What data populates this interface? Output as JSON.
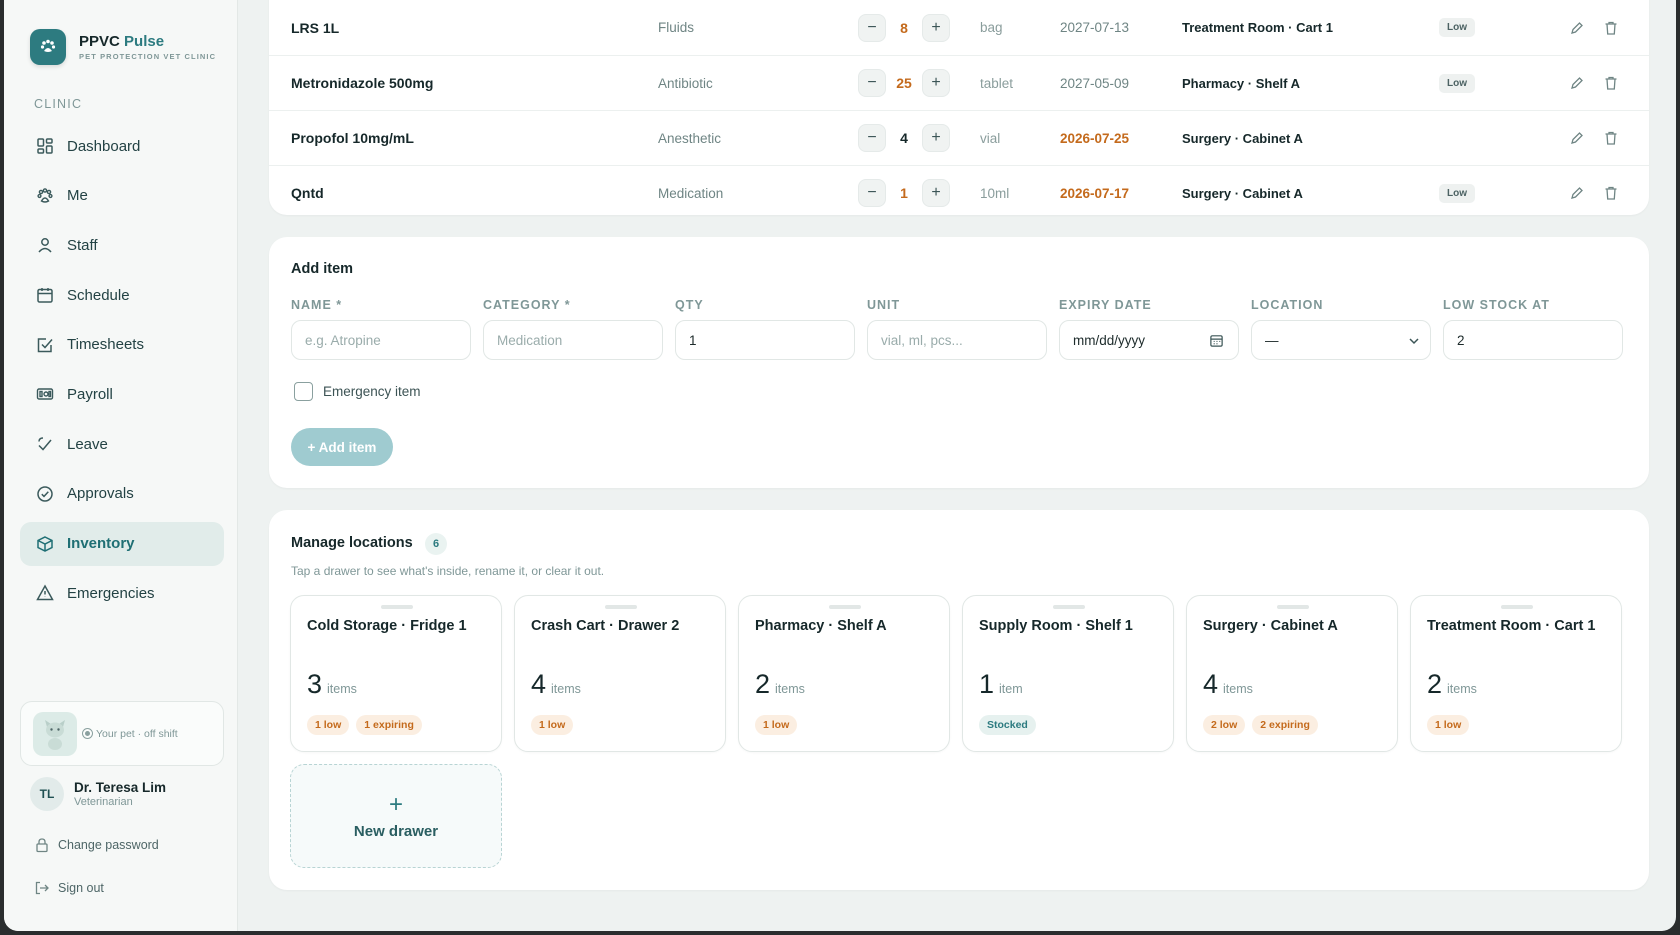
{
  "brand": {
    "name": "PPVC",
    "name_accent": "Pulse",
    "subtitle": "PET PROTECTION VET CLINIC"
  },
  "sidebar": {
    "section": "CLINIC",
    "items": [
      {
        "label": "Dashboard",
        "icon": "grid-icon"
      },
      {
        "label": "Me",
        "icon": "paw-icon"
      },
      {
        "label": "Staff",
        "icon": "user-icon"
      },
      {
        "label": "Schedule",
        "icon": "calendar-icon"
      },
      {
        "label": "Timesheets",
        "icon": "checkbox-icon"
      },
      {
        "label": "Payroll",
        "icon": "money-icon"
      },
      {
        "label": "Leave",
        "icon": "leave-icon"
      },
      {
        "label": "Approvals",
        "icon": "check-circle-icon"
      },
      {
        "label": "Inventory",
        "icon": "box-icon",
        "active": true
      },
      {
        "label": "Emergencies",
        "icon": "warning-icon"
      }
    ],
    "pet_status": "Your pet · off shift",
    "user": {
      "initials": "TL",
      "name": "Dr. Teresa Lim",
      "role": "Veterinarian"
    },
    "change_password": "Change password",
    "sign_out": "Sign out"
  },
  "inventory_rows": [
    {
      "name": "LRS 1L",
      "category": "Fluids",
      "qty": "8",
      "unit": "bag",
      "expiry": "2027-07-13",
      "location": "Treatment Room · Cart 1",
      "badge": "Low"
    },
    {
      "name": "Metronidazole 500mg",
      "category": "Antibiotic",
      "qty": "25",
      "unit": "tablet",
      "expiry": "2027-05-09",
      "location": "Pharmacy · Shelf A",
      "badge": "Low"
    },
    {
      "name": "Propofol 10mg/mL",
      "category": "Anesthetic",
      "qty": "4",
      "unit": "vial",
      "expiry": "2026-07-25",
      "location": "Surgery · Cabinet A",
      "badge": ""
    },
    {
      "name": "Qntd",
      "category": "Medication",
      "qty": "1",
      "unit": "10ml",
      "expiry": "2026-07-17",
      "location": "Surgery · Cabinet A",
      "badge": "Low"
    }
  ],
  "add_item": {
    "title": "Add item",
    "fields": {
      "name": {
        "label": "NAME *",
        "placeholder": "e.g. Atropine"
      },
      "category": {
        "label": "CATEGORY *",
        "placeholder": "Medication"
      },
      "qty": {
        "label": "QTY",
        "value": "1"
      },
      "unit": {
        "label": "UNIT",
        "placeholder": "vial, ml, pcs..."
      },
      "expiry": {
        "label": "EXPIRY DATE",
        "value": "mm/dd/yyyy"
      },
      "location": {
        "label": "LOCATION",
        "value": "—"
      },
      "low_stock": {
        "label": "LOW STOCK AT",
        "value": "2"
      }
    },
    "emergency_label": "Emergency item",
    "submit": "+ Add item"
  },
  "locations": {
    "title": "Manage locations",
    "count": "6",
    "subtitle": "Tap a drawer to see what's inside, rename it, or clear it out.",
    "drawers": [
      {
        "name": "Cold Storage · Fridge 1",
        "count": "3",
        "unit": "items",
        "tags": [
          {
            "text": "1 low",
            "kind": "low"
          },
          {
            "text": "1 expiring",
            "kind": "exp"
          }
        ]
      },
      {
        "name": "Crash Cart · Drawer 2",
        "count": "4",
        "unit": "items",
        "tags": [
          {
            "text": "1 low",
            "kind": "low"
          }
        ]
      },
      {
        "name": "Pharmacy · Shelf A",
        "count": "2",
        "unit": "items",
        "tags": [
          {
            "text": "1 low",
            "kind": "low"
          }
        ]
      },
      {
        "name": "Supply Room · Shelf 1",
        "count": "1",
        "unit": "item",
        "tags": [
          {
            "text": "Stocked",
            "kind": "ok"
          }
        ]
      },
      {
        "name": "Surgery · Cabinet A",
        "count": "4",
        "unit": "items",
        "tags": [
          {
            "text": "2 low",
            "kind": "low"
          },
          {
            "text": "2 expiring",
            "kind": "exp"
          }
        ]
      },
      {
        "name": "Treatment Room · Cart 1",
        "count": "2",
        "unit": "items",
        "tags": [
          {
            "text": "1 low",
            "kind": "low"
          }
        ]
      }
    ],
    "new_drawer": "New drawer"
  }
}
